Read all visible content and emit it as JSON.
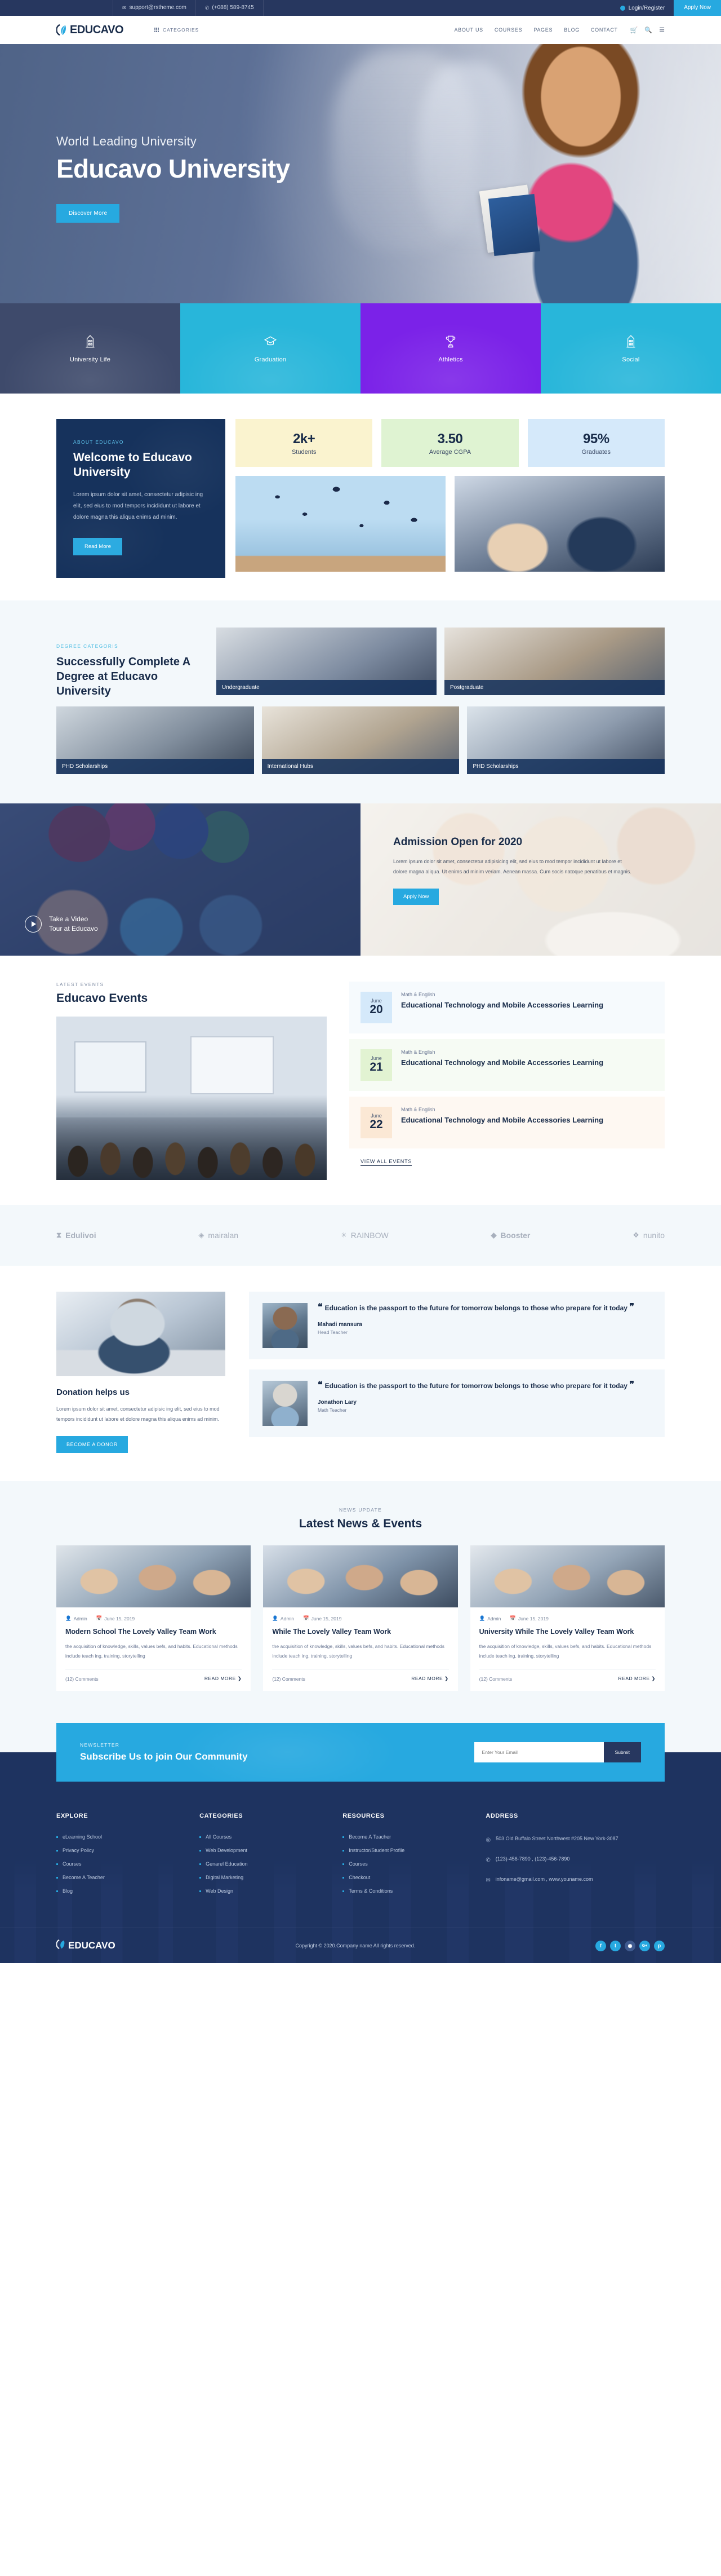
{
  "topbar": {
    "email": "support@rstheme.com",
    "phone": "(+088) 589-8745",
    "login": "Login/Register",
    "apply": "Apply Now",
    "email_icon": "mail-icon",
    "phone_icon": "phone-icon"
  },
  "header": {
    "brand": "EDUCAVO",
    "categories_label": "CATEGORIES",
    "nav": [
      "ABOUT US",
      "COURSES",
      "PAGES",
      "BLOG",
      "CONTACT"
    ]
  },
  "hero": {
    "subtitle": "World Leading University",
    "title": "Educavo University",
    "cta": "Discover More"
  },
  "tiles": [
    {
      "label": "University Life",
      "icon": "building-icon",
      "color": "#3E4A6B"
    },
    {
      "label": "Graduation",
      "icon": "graduation-cap-icon",
      "color": "#28B6DA"
    },
    {
      "label": "Athletics",
      "icon": "trophy-icon",
      "color": "#7B22E8"
    },
    {
      "label": "Social",
      "icon": "building-icon",
      "color": "#28B6DA"
    }
  ],
  "about": {
    "eyebrow": "ABOUT EDUCAVO",
    "title": "Welcome to Educavo University",
    "paragraph": "Lorem ipsum dolor sit amet, consectetur adipisic ing elit, sed eius to mod tempors incididunt ut labore et dolore magna this aliqua enims ad minim.",
    "cta": "Read More",
    "stats": [
      {
        "value": "2k+",
        "label": "Students"
      },
      {
        "value": "3.50",
        "label": "Average CGPA"
      },
      {
        "value": "95%",
        "label": "Graduates"
      }
    ]
  },
  "degrees": {
    "eyebrow": "DEGREE CATEGORIS",
    "title": "Successfully Complete A Degree at Educavo University",
    "cards": [
      {
        "label": "Undergraduate"
      },
      {
        "label": "Postgraduate"
      },
      {
        "label": "PHD Scholarships"
      },
      {
        "label": "International Hubs"
      },
      {
        "label": "PHD Scholarships"
      }
    ]
  },
  "video": {
    "line1": "Take a Video",
    "line2": "Tour at Educavo",
    "play_icon": "play-icon"
  },
  "admission": {
    "title": "Admission Open for 2020",
    "paragraph": "Lorem ipsum dolor sit amet, consectetur adipisicing elit, sed eius to mod tempor incididunt ut labore et dolore magna aliqua. Ut enims ad minim veriam. Aenean massa. Cum socis natoque penatibus et magnis.",
    "cta": "Apply Now"
  },
  "events": {
    "eyebrow": "LATEST EVENTS",
    "title": "Educavo Events",
    "view_all": "VIEW ALL EVENTS",
    "items": [
      {
        "month": "June",
        "day": "20",
        "meta": "Math & English",
        "title": "Educational Technology and Mobile Accessories Learning"
      },
      {
        "month": "June",
        "day": "21",
        "meta": "Math & English",
        "title": "Educational Technology and Mobile Accessories Learning"
      },
      {
        "month": "June",
        "day": "22",
        "meta": "Math & English",
        "title": "Educational Technology and Mobile Accessories Learning"
      }
    ]
  },
  "brands": [
    {
      "name": "Edulivoi",
      "icon": "edulivoi-icon"
    },
    {
      "name": "mairalan",
      "icon": "diamond-icon"
    },
    {
      "name": "RAINBOW",
      "icon": "burst-icon"
    },
    {
      "name": "Booster",
      "icon": "rocket-icon"
    },
    {
      "name": "nunito",
      "icon": "leaf-icon"
    }
  ],
  "donation": {
    "title": "Donation helps us",
    "paragraph": "Lorem ipsum dolor sit amet, consectetur adipisic ing elit, sed eius to mod tempors incididunt ut labore et dolore magna this aliqua enims ad minim.",
    "cta": "BECOME A DONOR"
  },
  "testimonials": [
    {
      "quote": "Education is the passport to the future for tomorrow belongs to those who prepare for it today",
      "name": "Mahadi mansura",
      "role": "Head Teacher"
    },
    {
      "quote": "Education is the passport to the future for tomorrow belongs to those who prepare for it today",
      "name": "Jonathon Lary",
      "role": "Math Teacher"
    }
  ],
  "news": {
    "eyebrow": "NEWS UPDATE",
    "title": "Latest News & Events",
    "cards": [
      {
        "author": "Admin",
        "date": "June 15, 2019",
        "title": "Modern School The Lovely Valley Team Work",
        "excerpt": "the acquisition of knowledge, skills, values befs, and habits. Educational methods include teach ing, training, storytelling",
        "comments": "(12) Comments",
        "read_more": "READ MORE"
      },
      {
        "author": "Admin",
        "date": "June 15, 2019",
        "title": "While The Lovely Valley Team Work",
        "excerpt": "the acquisition of knowledge, skills, values befs, and habits. Educational methods include teach ing, training, storytelling",
        "comments": "(12) Comments",
        "read_more": "READ MORE"
      },
      {
        "author": "Admin",
        "date": "June 15, 2019",
        "title": "University While The Lovely Valley Team Work",
        "excerpt": "the acquisition of knowledge, skills, values befs, and habits. Educational methods include teach ing, training, storytelling",
        "comments": "(12) Comments",
        "read_more": "READ MORE"
      }
    ]
  },
  "newsletter": {
    "eyebrow": "NEWSLETTER",
    "title": "Subscribe Us to join Our Community",
    "placeholder": "Enter Your Email",
    "submit": "Submit"
  },
  "footer": {
    "columns": [
      {
        "head": "EXPLORE",
        "links": [
          "eLearning School",
          "Privacy Policy",
          "Courses",
          "Become A Teacher",
          "Blog"
        ]
      },
      {
        "head": "CATEGORIES",
        "links": [
          "All Courses",
          "Web Development",
          "Genarel Education",
          "Digital Marketing",
          "Web Design"
        ]
      },
      {
        "head": "RESOURCES",
        "links": [
          "Become A Teacher",
          "Instructor/Student Profile",
          "Courses",
          "Checkout",
          "Terms & Conditions"
        ]
      }
    ],
    "address": {
      "head": "ADDRESS",
      "lines": [
        {
          "icon": "location-pin-icon",
          "text": "503 Old Buffalo Street Northwest #205 New York-3087"
        },
        {
          "icon": "phone-icon",
          "text": "(123)-456-7890 , (123)-456-7890"
        },
        {
          "icon": "mail-icon",
          "text": "infoname@gmail.com , www.youname.com"
        }
      ]
    },
    "brand": "EDUCAVO",
    "copyright": "Copyright © 2020.Company name All rights reserved.",
    "socials": [
      {
        "name": "facebook-icon",
        "glyph": "f"
      },
      {
        "name": "twitter-icon",
        "glyph": "t"
      },
      {
        "name": "instagram-icon",
        "glyph": "◉"
      },
      {
        "name": "google-plus-icon",
        "glyph": "G+"
      },
      {
        "name": "pinterest-icon",
        "glyph": "p"
      }
    ]
  },
  "colors": {
    "accent": "#27A9E0",
    "navy": "#1E3360",
    "dark": "#182B49",
    "purple": "#7B22E8"
  }
}
